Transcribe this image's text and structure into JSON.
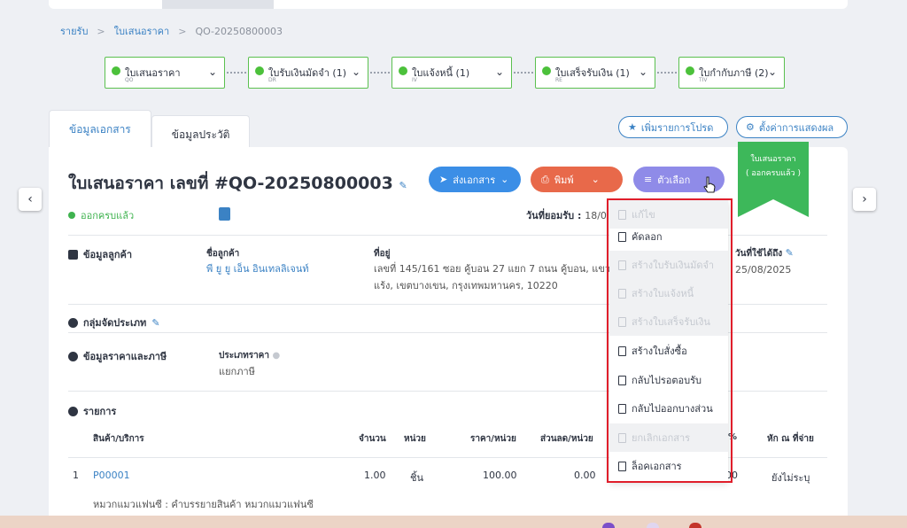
{
  "breadcrumb": {
    "income": "รายรับ",
    "quotation": "ใบเสนอราคา",
    "current": "QO-20250800003",
    "sep": ">"
  },
  "flow": [
    {
      "name": "ใบเสนอราคา",
      "code": "QO"
    },
    {
      "name": "ใบรับเงินมัดจำ (1)",
      "code": "DR"
    },
    {
      "name": "ใบแจ้งหนี้ (1)",
      "code": "IV"
    },
    {
      "name": "ใบเสร็จรับเงิน (1)",
      "code": "RE"
    },
    {
      "name": "ใบกำกับภาษี (2)",
      "code": "TIV"
    }
  ],
  "tabs": {
    "document": "ข้อมูลเอกสาร",
    "history": "ข้อมูลประวัติ"
  },
  "actions": {
    "favorite": "เพิ่มรายการโปรด",
    "display_settings": "ตั้งค่าการแสดงผล"
  },
  "ribbon": {
    "line1": "ใบเสนอราคา",
    "line2": "( ออกครบแล้ว )"
  },
  "doc": {
    "title": "ใบเสนอราคา เลขที่ #QO-20250800003",
    "status": "ออกครบแล้ว",
    "accept_label": "วันที่ยอมรับ :",
    "accept_value": "18/0"
  },
  "buttons": {
    "send": "ส่งเอกสาร",
    "print": "พิมพ์",
    "options": "ตัวเลือก"
  },
  "customer": {
    "section": "ข้อมูลลูกค้า",
    "name_label": "ชื่อลูกค้า",
    "name": "พี ยู ยู เอ็น อินเทลลิเจนท์",
    "address_label": "ที่อยู่",
    "address1": "เลขที่ 145/161 ซอย คู้บอน 27 แยก 7 ถนน คู้บอน, แขวงท",
    "address2": "แร้ง, เขตบางเขน, กรุงเทพมหานคร, 10220",
    "valid_label": "วันที่ใช้ได้ถึง",
    "valid_value": "25/08/2025"
  },
  "group": {
    "section": "กลุ่มจัดประเภท"
  },
  "pricing": {
    "section": "ข้อมูลราคาและภาษี",
    "type_label": "ประเภทราคา",
    "type_value": "แยกภาษี"
  },
  "items": {
    "section": "รายการ",
    "headers": {
      "product": "สินค้า/บริการ",
      "qty": "จำนวน",
      "unit": "หน่วย",
      "price": "ราคา/หน่วย",
      "discount": "ส่วนลด/หน่วย",
      "vat_pct": "%",
      "wht": "หัก ณ ที่จ่าย"
    },
    "row": {
      "index": "1",
      "code": "P00001",
      "qty": "1.00",
      "unit": "ชิ้น",
      "price": "100.00",
      "discount": "0.00",
      "amount_tail": "00",
      "wht": "ยังไม่ระบุ"
    },
    "note": "หมวกแมวแฟนซี : คำบรรยายสินค้า หมวกแมวแฟนซี"
  },
  "menu": [
    {
      "label": "แก้ไข",
      "enabled": false
    },
    {
      "label": "คัดลอก",
      "enabled": true
    },
    {
      "label": "สร้างใบรับเงินมัดจำ",
      "enabled": false
    },
    {
      "label": "สร้างใบแจ้งหนี้",
      "enabled": false
    },
    {
      "label": "สร้างใบเสร็จรับเงิน",
      "enabled": false
    },
    {
      "label": "สร้างใบสั่งซื้อ",
      "enabled": true
    },
    {
      "label": "กลับไปรอตอบรับ",
      "enabled": true
    },
    {
      "label": "กลับไปออกบางส่วน",
      "enabled": true
    },
    {
      "label": "ยกเลิกเอกสาร",
      "enabled": false
    },
    {
      "label": "ล็อคเอกสาร",
      "enabled": true
    }
  ],
  "colors": {
    "accent": "#3b82c4",
    "success": "#4cc13b",
    "highlight": "#e01e2b",
    "ribbon": "#3db85a"
  }
}
